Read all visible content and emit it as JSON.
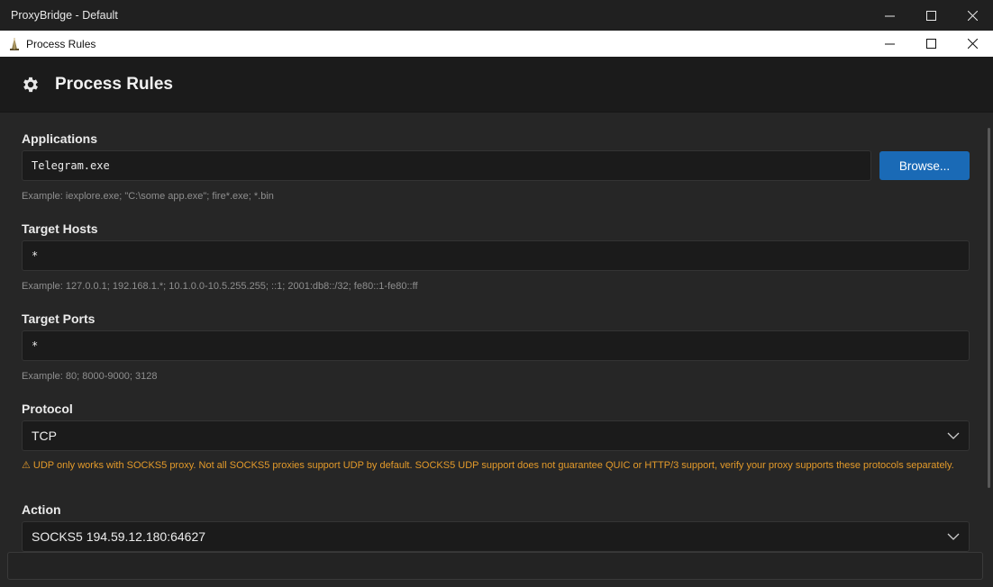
{
  "outer_window": {
    "title": "ProxyBridge - Default"
  },
  "inner_window": {
    "title": "Process Rules"
  },
  "header": {
    "title": "Process Rules"
  },
  "applications": {
    "label": "Applications",
    "value": "Telegram.exe",
    "browse_label": "Browse...",
    "hint": "Example: iexplore.exe; \"C:\\some app.exe\"; fire*.exe; *.bin"
  },
  "target_hosts": {
    "label": "Target Hosts",
    "value": "*",
    "hint": "Example: 127.0.0.1; 192.168.1.*; 10.1.0.0-10.5.255.255; ::1; 2001:db8::/32; fe80::1-fe80::ff"
  },
  "target_ports": {
    "label": "Target Ports",
    "value": "*",
    "hint": "Example: 80; 8000-9000; 3128"
  },
  "protocol": {
    "label": "Protocol",
    "selected": "TCP",
    "warning": "⚠ UDP only works with SOCKS5 proxy. Not all SOCKS5 proxies support UDP by default. SOCKS5 UDP support does not guarantee QUIC or HTTP/3 support, verify your proxy supports these protocols separately."
  },
  "action": {
    "label": "Action",
    "selected": "SOCKS5 194.59.12.180:64627"
  },
  "colors": {
    "accent": "#1a6ab6",
    "warning": "#e39a2a",
    "background": "#262626"
  }
}
